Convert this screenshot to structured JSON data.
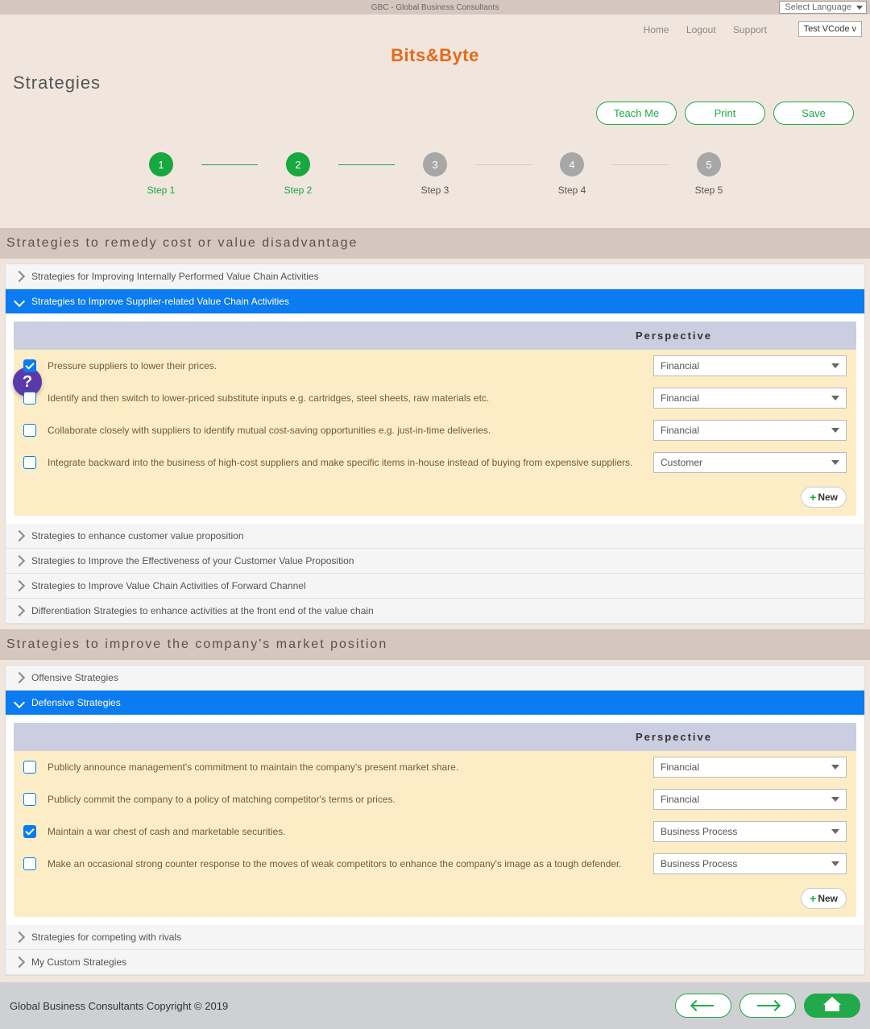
{
  "topbar": {
    "title": "GBC - Global Business Consultants",
    "langLabel": "Select Language"
  },
  "header": {
    "links": [
      "Home",
      "Logout",
      "Support"
    ],
    "vcode": "Test VCode  v",
    "logo": "Bits&Byte",
    "pageTitle": "Strategies"
  },
  "actions": {
    "teach": "Teach Me",
    "print": "Print",
    "save": "Save"
  },
  "steps": [
    "Step 1",
    "Step 2",
    "Step 3",
    "Step 4",
    "Step 5"
  ],
  "section1": {
    "title": "Strategies to remedy cost or value disadvantage",
    "acc": [
      "Strategies for Improving Internally Performed Value Chain Activities",
      "Strategies to Improve Supplier-related Value Chain Activities",
      "Strategies to enhance customer value proposition",
      "Strategies to Improve the Effectiveness of your Customer Value Proposition",
      "Strategies to Improve Value Chain Activities of Forward Channel",
      "Differentiation Strategies to enhance activities at the front end of the value chain"
    ],
    "perspectiveHeader": "Perspective",
    "rows": [
      {
        "checked": true,
        "text": "Pressure suppliers to lower their prices.",
        "sel": "Financial"
      },
      {
        "checked": false,
        "text": "Identify and then switch to lower-priced substitute inputs e.g. cartridges, steel sheets, raw materials etc.",
        "sel": "Financial"
      },
      {
        "checked": false,
        "text": "Collaborate closely with suppliers to identify mutual cost-saving opportunities e.g. just-in-time deliveries.",
        "sel": "Financial"
      },
      {
        "checked": false,
        "text": "Integrate backward into the business of high-cost suppliers and make specific items in-house instead of buying from expensive suppliers.",
        "sel": "Customer"
      }
    ],
    "newLabel": "New"
  },
  "section2": {
    "title": "Strategies to improve the company's market position",
    "acc": [
      "Offensive Strategies",
      "Defensive Strategies",
      "Strategies for competing with rivals",
      "My Custom Strategies"
    ],
    "perspectiveHeader": "Perspective",
    "rows": [
      {
        "checked": false,
        "text": "Publicly announce management's commitment to maintain the company's present market share.",
        "sel": "Financial"
      },
      {
        "checked": false,
        "text": "Publicly commit the company to a policy of matching competitor's terms or prices.",
        "sel": "Financial"
      },
      {
        "checked": true,
        "text": "Maintain a war chest of cash and marketable securities.",
        "sel": "Business Process"
      },
      {
        "checked": false,
        "text": "Make an occasional strong counter response to the moves of weak competitors to enhance the company's image as a tough defender.",
        "sel": "Business Process"
      }
    ],
    "newLabel": "New"
  },
  "footer": {
    "copy": "Global Business Consultants Copyright © 2019"
  }
}
